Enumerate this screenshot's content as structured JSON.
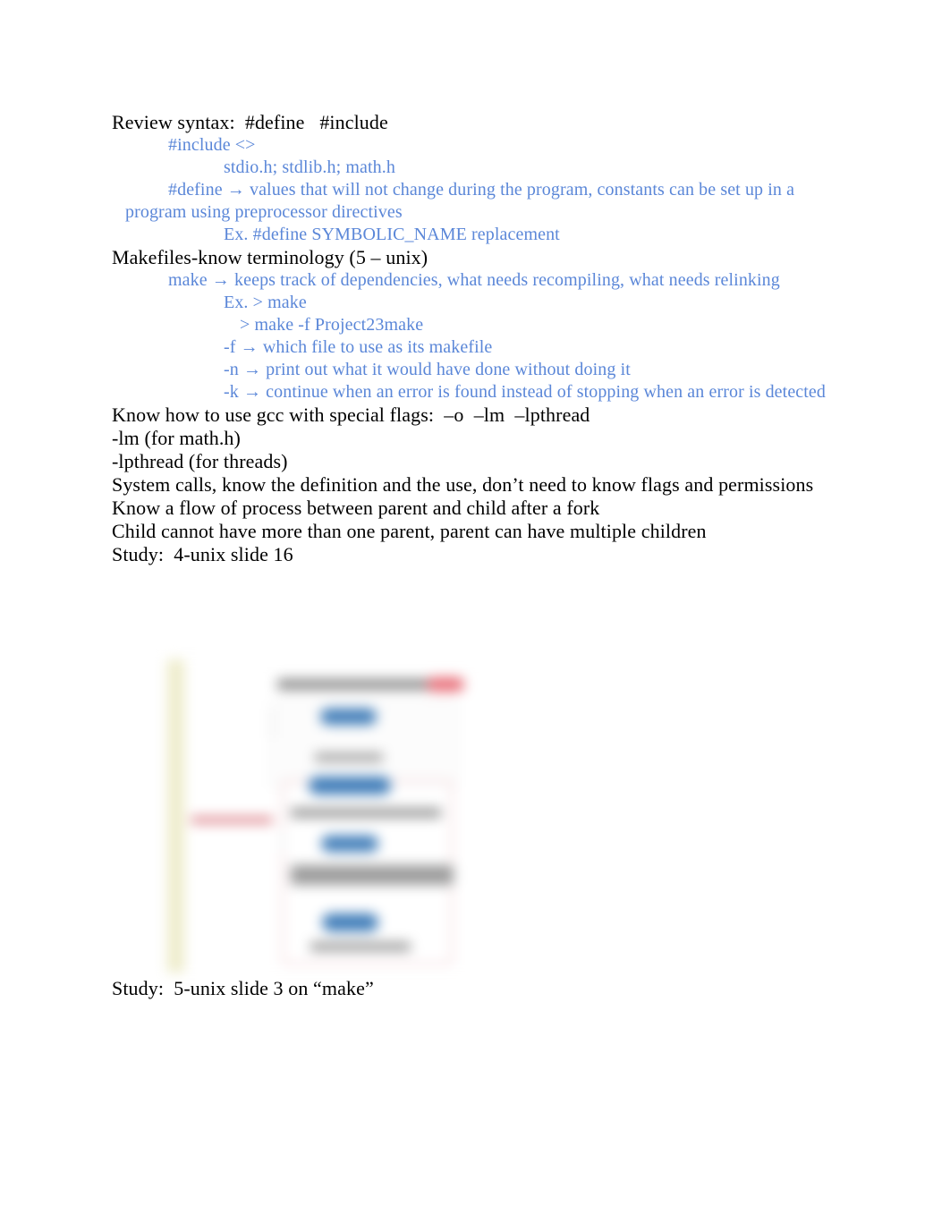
{
  "document": {
    "page_background": "#ffffff",
    "text_color_primary": "#000000",
    "text_color_secondary": "#5b87d8",
    "lines": [
      {
        "id": "l01",
        "text": "Review syntax:  #define   #include",
        "color": "black",
        "indent": "i0"
      },
      {
        "id": "l02",
        "text": "#include <>",
        "color": "blue",
        "indent": "i1"
      },
      {
        "id": "l03",
        "text": "stdio.h; stdlib.h; math.h",
        "color": "blue",
        "indent": "i2"
      },
      {
        "id": "l04",
        "text": "#define → values that will not change during the program, constants can be set up in a program using preprocessor directives",
        "color": "blue",
        "indent": "i1"
      },
      {
        "id": "l05",
        "text": "Ex. #define SYMBOLIC_NAME replacement",
        "color": "blue",
        "indent": "i2"
      },
      {
        "id": "l06",
        "text": "Makefiles-know terminology (5 – unix)",
        "color": "black",
        "indent": "i0"
      },
      {
        "id": "l07",
        "text": "make → keeps track of dependencies, what needs recompiling, what needs relinking",
        "color": "blue",
        "indent": "i1"
      },
      {
        "id": "l08",
        "text": "Ex. > make",
        "color": "blue",
        "indent": "i2"
      },
      {
        "id": "l09",
        "text": "> make -f Project23make",
        "color": "blue",
        "indent": "i3"
      },
      {
        "id": "l10",
        "text": "-f → which file to use as its makefile",
        "color": "blue",
        "indent": "i2"
      },
      {
        "id": "l11",
        "text": "-n → print out what it would have done without doing it",
        "color": "blue",
        "indent": "i2"
      },
      {
        "id": "l12",
        "text": "-k → continue when an error is found instead of stopping when an error is detected",
        "color": "blue",
        "indent": "i2"
      },
      {
        "id": "l13",
        "text": "Know how to use gcc with special flags:  –o  –lm  –lpthread",
        "color": "black",
        "indent": "i0"
      },
      {
        "id": "l14",
        "text": "-lm (for math.h)",
        "color": "black",
        "indent": "i0"
      },
      {
        "id": "l15",
        "text": "-lpthread (for threads)",
        "color": "black",
        "indent": "i0"
      },
      {
        "id": "l16",
        "text": "System calls, know the definition and the use, don’t need to know flags and permissions",
        "color": "black",
        "indent": "i0"
      },
      {
        "id": "l17",
        "text": "Know a flow of process between parent and child after a fork",
        "color": "black",
        "indent": "i0"
      },
      {
        "id": "l18",
        "text": "Child cannot have more than one parent, parent can have multiple children",
        "color": "black",
        "indent": "i0"
      },
      {
        "id": "l19",
        "text": "Study:  4-unix slide 16",
        "color": "black",
        "indent": "i0"
      }
    ],
    "closing_line": "Study:  5-unix slide 3 on “make”"
  },
  "figure": {
    "description": "blurred slide screenshot of a program development flowchart",
    "colors": {
      "left_strip": "#eeeccb",
      "node_fill": "#3f7cb8",
      "container_border": "#f0c8cc",
      "accent_red": "#e8707a",
      "label_grey": "#9a9a9a"
    }
  }
}
